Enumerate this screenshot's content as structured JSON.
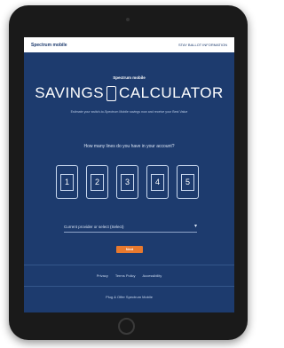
{
  "header": {
    "logo": "Spectrum mobile",
    "link": "STAY BALLOT INFORMATION"
  },
  "hero": {
    "logo": "Spectrum mobile",
    "title_left": "SAVINGS",
    "title_right": "CALCULATOR",
    "intro": "Estimate your switch-to-Spectrum Mobile savings now and receive your Best Value"
  },
  "question": "How many lines do you have in your account?",
  "line_options": [
    "1",
    "2",
    "3",
    "4",
    "5"
  ],
  "select": {
    "label": "Current provider or select (Select)",
    "caret": "▾"
  },
  "next_button": "Next",
  "footer": {
    "links": [
      "Privacy",
      "Terms Policy",
      "Accessibility"
    ],
    "legal": "Plug & Offer Spectrum Mobile"
  },
  "colors": {
    "screen_bg": "#1d3b6e",
    "accent": "#e8792e",
    "text_light": "#ffffff"
  },
  "icons": [
    "phone-icon",
    "chevron-down-icon"
  ]
}
